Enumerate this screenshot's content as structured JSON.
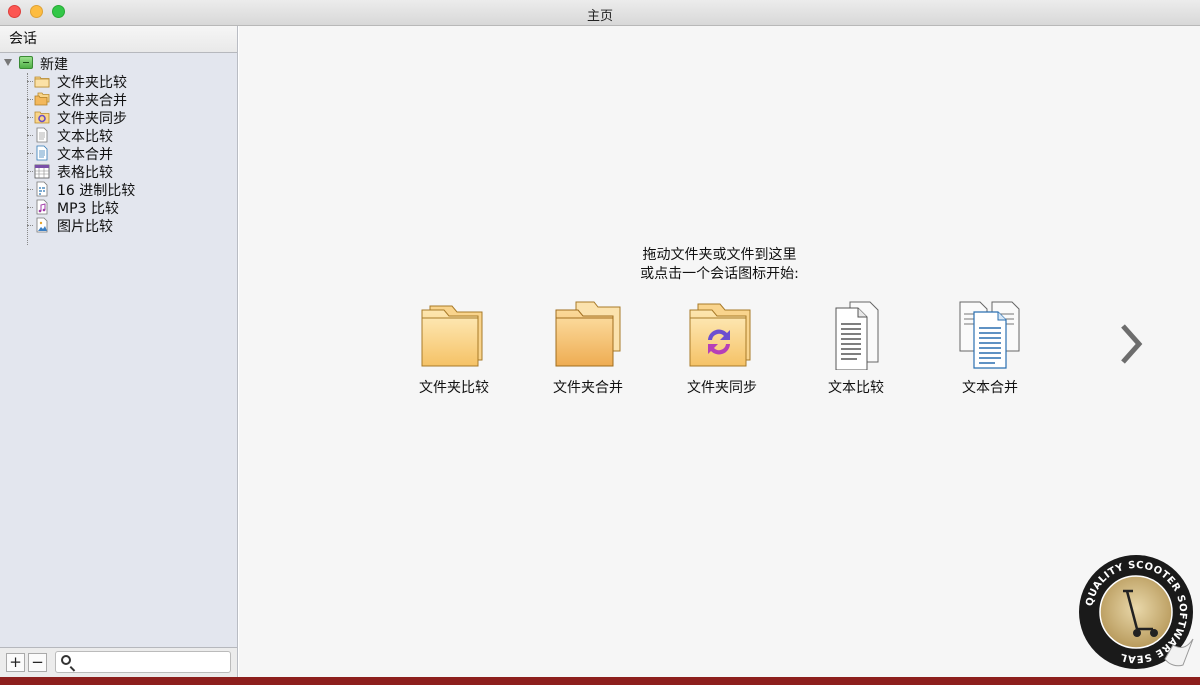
{
  "window": {
    "title": "主页"
  },
  "sidebar": {
    "header": "会话",
    "root": {
      "label": "新建",
      "icon": "new-session-icon"
    },
    "items": [
      {
        "label": "文件夹比较",
        "icon": "folder-compare-icon"
      },
      {
        "label": "文件夹合并",
        "icon": "folder-merge-icon"
      },
      {
        "label": "文件夹同步",
        "icon": "folder-sync-icon"
      },
      {
        "label": "文本比较",
        "icon": "text-compare-icon"
      },
      {
        "label": "文本合并",
        "icon": "text-merge-icon"
      },
      {
        "label": "表格比较",
        "icon": "table-compare-icon"
      },
      {
        "label": "16 进制比较",
        "icon": "hex-compare-icon"
      },
      {
        "label": "MP3 比较",
        "icon": "mp3-compare-icon"
      },
      {
        "label": "图片比较",
        "icon": "picture-compare-icon"
      }
    ],
    "footer": {
      "add_label": "+",
      "remove_label": "−",
      "search_placeholder": ""
    }
  },
  "main": {
    "hint_line1": "拖动文件夹或文件到这里",
    "hint_line2": "或点击一个会话图标开始:",
    "sessions": [
      {
        "label": "文件夹比较",
        "icon": "folder-compare-icon"
      },
      {
        "label": "文件夹合并",
        "icon": "folder-merge-icon"
      },
      {
        "label": "文件夹同步",
        "icon": "folder-sync-icon"
      },
      {
        "label": "文本比较",
        "icon": "text-compare-icon"
      },
      {
        "label": "文本合并",
        "icon": "text-merge-icon"
      }
    ],
    "next_icon": "chevron-right-icon"
  },
  "seal": {
    "text": "QUALITY SCOOTER SOFTWARE SEAL",
    "icon": "scooter-seal-icon"
  },
  "colors": {
    "bottom_bar": "#8d1f1d",
    "folder": "#f7c76a",
    "sidebar_bg": "#e3e6ee"
  }
}
